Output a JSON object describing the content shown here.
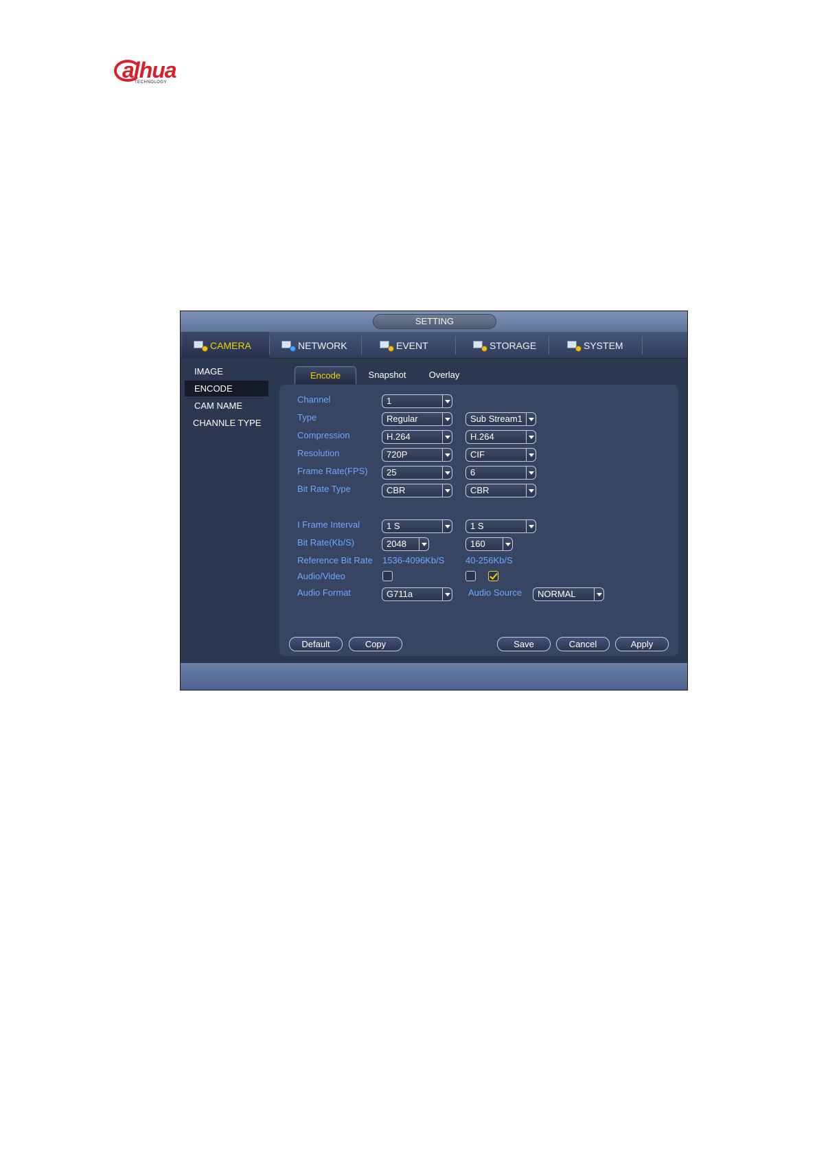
{
  "logo": {
    "text": "alhua",
    "sub": "TECHNOLOGY"
  },
  "window": {
    "title": "SETTING"
  },
  "nav": {
    "tabs": [
      {
        "label": "CAMERA",
        "icon": "camera-icon",
        "active": true
      },
      {
        "label": "NETWORK",
        "icon": "network-icon",
        "active": false
      },
      {
        "label": "EVENT",
        "icon": "event-icon",
        "active": false
      },
      {
        "label": "STORAGE",
        "icon": "storage-icon",
        "active": false
      },
      {
        "label": "SYSTEM",
        "icon": "system-icon",
        "active": false
      }
    ]
  },
  "sidebar": {
    "items": [
      {
        "label": "IMAGE",
        "active": false
      },
      {
        "label": "ENCODE",
        "active": true
      },
      {
        "label": "CAM NAME",
        "active": false
      },
      {
        "label": "CHANNLE TYPE",
        "active": false
      }
    ]
  },
  "subtabs": [
    {
      "label": "Encode",
      "active": true
    },
    {
      "label": "Snapshot",
      "active": false
    },
    {
      "label": "Overlay",
      "active": false
    }
  ],
  "form": {
    "channel": {
      "label": "Channel",
      "value": "1"
    },
    "type": {
      "label": "Type",
      "main": "Regular",
      "sub": "Sub Stream1"
    },
    "compression": {
      "label": "Compression",
      "main": "H.264",
      "sub": "H.264"
    },
    "resolution": {
      "label": "Resolution",
      "main": "720P",
      "sub": "CIF"
    },
    "frame_rate": {
      "label": "Frame Rate(FPS)",
      "main": "25",
      "sub": "6"
    },
    "bit_rate_type": {
      "label": "Bit Rate Type",
      "main": "CBR",
      "sub": "CBR"
    },
    "i_frame_interval": {
      "label": "I Frame Interval",
      "main": "1 S",
      "sub": "1 S"
    },
    "bit_rate": {
      "label": "Bit Rate(Kb/S)",
      "main": "2048",
      "sub": "160"
    },
    "reference_bit_rate": {
      "label": "Reference Bit Rate",
      "main": "1536-4096Kb/S",
      "sub": "40-256Kb/S"
    },
    "audio_video": {
      "label": "Audio/Video",
      "main_checked": false,
      "sub_checked": false,
      "sub_video_checked": true
    },
    "audio_format": {
      "label": "Audio Format",
      "value": "G711a"
    },
    "audio_source": {
      "label": "Audio Source",
      "value": "NORMAL"
    }
  },
  "buttons": {
    "default": "Default",
    "copy": "Copy",
    "save": "Save",
    "cancel": "Cancel",
    "apply": "Apply"
  },
  "colors": {
    "accent_yellow": "#f0d200",
    "label_blue": "#6fa8ff",
    "brand_red": "#d8202a"
  }
}
